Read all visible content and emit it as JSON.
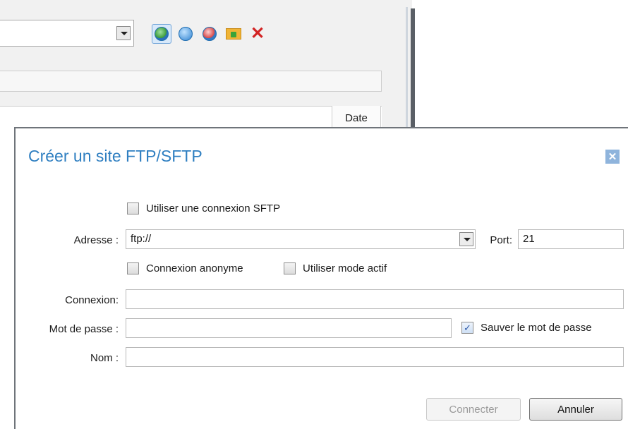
{
  "background": {
    "date_column": "Date"
  },
  "dialog": {
    "title": "Créer un site FTP/SFTP",
    "close_glyph": "✕",
    "sftp_checkbox": {
      "label": "Utiliser une connexion SFTP",
      "checked": false
    },
    "address": {
      "label": "Adresse :",
      "value": "ftp://"
    },
    "port": {
      "label": "Port:",
      "value": "21"
    },
    "anonymous_checkbox": {
      "label": "Connexion anonyme",
      "checked": false
    },
    "active_mode_checkbox": {
      "label": "Utiliser mode actif",
      "checked": false
    },
    "login": {
      "label": "Connexion:",
      "value": ""
    },
    "password": {
      "label": "Mot de passe :",
      "value": ""
    },
    "save_password_checkbox": {
      "label": "Sauver le mot de passe",
      "checked": true,
      "check_glyph": "✓"
    },
    "name": {
      "label": "Nom :",
      "value": ""
    },
    "connect_button": "Connecter",
    "cancel_button": "Annuler"
  },
  "icons": {
    "toolbar": [
      "connect-icon",
      "edit-icon",
      "disconnect-icon",
      "add-folder-icon",
      "delete-icon"
    ],
    "close": "close-icon"
  },
  "colors": {
    "title": "#2f7fc1",
    "accent": "#8fb4dc"
  }
}
